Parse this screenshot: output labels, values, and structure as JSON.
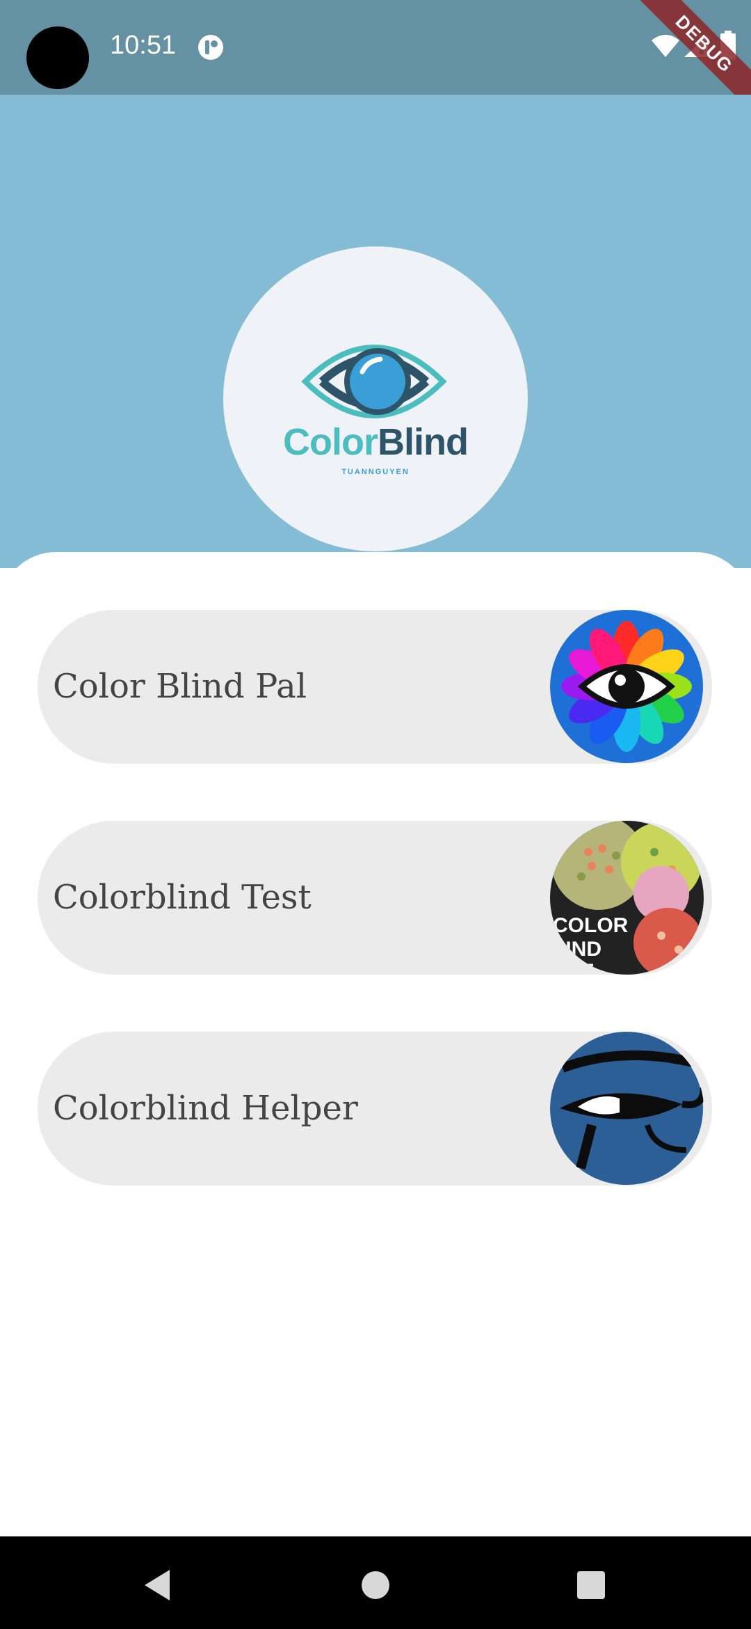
{
  "status_bar": {
    "time": "10:51",
    "debug_label": "DEBUG"
  },
  "header": {
    "logo_text_color": "Color",
    "logo_text_blind": "Blind",
    "logo_subtext": "TUANNGUYEN"
  },
  "apps": [
    {
      "label": "Color Blind Pal",
      "icon": "rainbow-eye-icon"
    },
    {
      "label": "Colorblind Test",
      "icon": "ishihara-test-icon"
    },
    {
      "label": "Colorblind Helper",
      "icon": "eye-of-horus-icon"
    }
  ],
  "nav": {
    "back": "back-triangle-icon",
    "home": "home-circle-icon",
    "recents": "recents-square-icon"
  },
  "colors": {
    "status_bar": "#6592a2",
    "header": "#83bcd4",
    "logo_circle": "#eff2f6",
    "pill": "#ebebeb",
    "label_text": "#444444"
  }
}
